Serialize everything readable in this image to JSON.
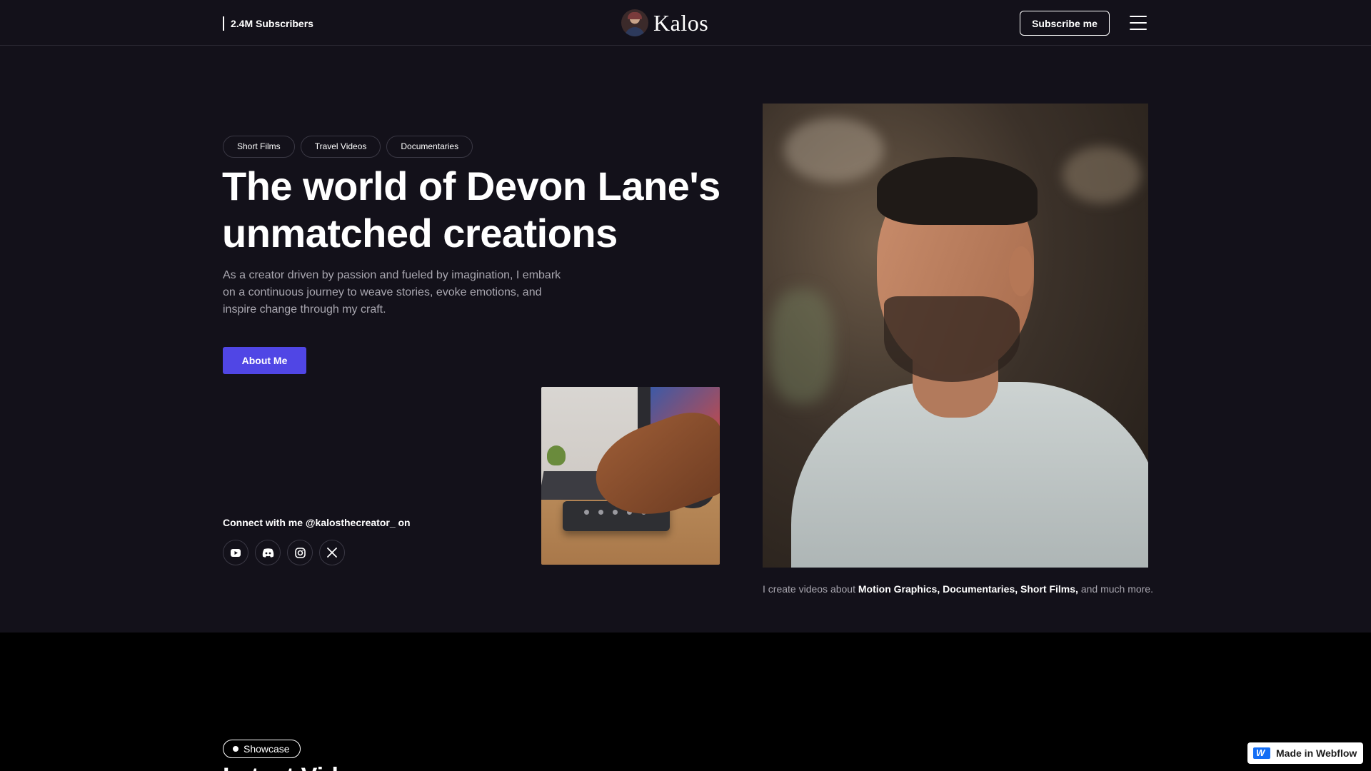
{
  "header": {
    "subscribers": "2.4M Subscribers",
    "brand_name": "Kalos",
    "subscribe_label": "Subscribe me"
  },
  "hero": {
    "tags": [
      "Short Films",
      "Travel Videos",
      "Documentaries"
    ],
    "title_line1": "The world of Devon Lane's",
    "title_line2": "unmatched creations",
    "description": "As a creator driven by passion and fueled by imagination, I embark on a continuous journey to weave stories, evoke emotions, and inspire change through my craft.",
    "about_label": "About Me",
    "connect_text": "Connect with me @kalosthecreator_ on",
    "socials": [
      "youtube-icon",
      "discord-icon",
      "instagram-icon",
      "x-icon"
    ],
    "caption": {
      "prefix": "I create videos about",
      "highlight": "Motion Graphics, Documentaries, Short Films,",
      "suffix": "and much more."
    }
  },
  "showcase": {
    "badge": "Showcase",
    "heading": "Latest Videos"
  },
  "badge": {
    "label": "Made in Webflow"
  },
  "colors": {
    "background": "#13111a",
    "accent": "#5046e5",
    "muted_text": "#a9a7b0",
    "section_dark": "#000000",
    "webflow_blue": "#146ef5"
  }
}
